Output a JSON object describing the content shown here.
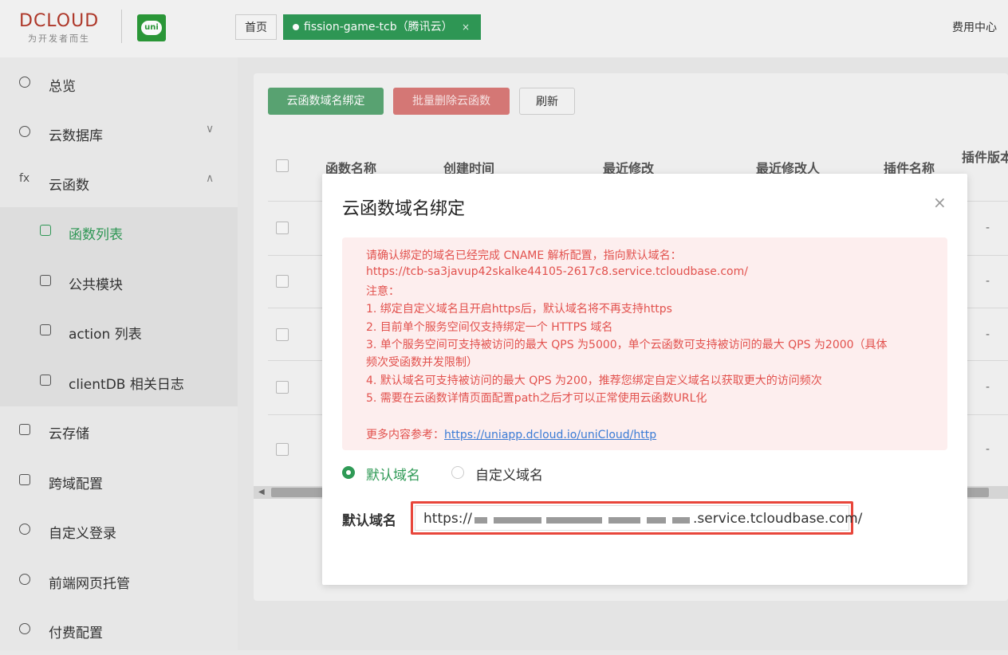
{
  "header": {
    "logo_text": "DCLOUD",
    "logo_subtitle": "为开发者而生",
    "uni_badge": "uni",
    "tabs": [
      {
        "label": "首页"
      },
      {
        "label": "fission-game-tcb（腾讯云）",
        "close": "×"
      }
    ],
    "fee_center": "费用中心"
  },
  "sidebar": {
    "items": [
      {
        "label": "总览",
        "icon": "overview-icon"
      },
      {
        "label": "云数据库",
        "icon": "database-icon",
        "arrow": "∨"
      },
      {
        "label": "云函数",
        "icon": "fx-icon",
        "icon_text": "fx",
        "arrow": "∧"
      },
      {
        "label": "函数列表",
        "icon": "list-icon"
      },
      {
        "label": "公共模块",
        "icon": "cube-icon"
      },
      {
        "label": "action 列表",
        "icon": "doc-icon"
      },
      {
        "label": "clientDB 相关日志",
        "icon": "log-icon"
      },
      {
        "label": "云存储",
        "icon": "storage-icon"
      },
      {
        "label": "跨域配置",
        "icon": "cors-icon"
      },
      {
        "label": "自定义登录",
        "icon": "shield-icon"
      },
      {
        "label": "前端网页托管",
        "icon": "hosting-icon"
      },
      {
        "label": "付费配置",
        "icon": "payment-icon"
      }
    ]
  },
  "main": {
    "buttons": {
      "bind_domain": "云函数域名绑定",
      "batch_delete": "批量删除云函数",
      "refresh": "刷新"
    },
    "columns": [
      "函数名称",
      "创建时间",
      "最近修改",
      "最近修改人",
      "插件名称",
      "插件版本号"
    ],
    "row_dash": "-"
  },
  "dialog": {
    "title": "云函数域名绑定",
    "close": "×",
    "alert_lines": [
      "请确认绑定的域名已经完成 CNAME 解析配置，指向默认域名：",
      "https://tcb-sa3javup42skalke44105-2617c8.service.tcloudbase.com/",
      "注意：",
      "1. 绑定自定义域名且开启https后，默认域名将不再支持https",
      "2. 目前单个服务空间仅支持绑定一个 HTTPS 域名",
      "3. 单个服务空间可支持被访问的最大 QPS 为5000，单个云函数可支持被访问的最大 QPS 为2000（具体",
      "频次受函数并发限制）",
      "4. 默认域名可支持被访问的最大 QPS 为200，推荐您绑定自定义域名以获取更大的访问频次",
      "5. 需要在云函数详情页面配置path之后才可以正常使用云函数URL化"
    ],
    "more_ref_label": "更多内容参考：",
    "more_ref_link": "https://uniapp.dcloud.io/uniCloud/http",
    "radio_default": "默认域名",
    "radio_custom": "自定义域名",
    "field_label": "默认域名",
    "field_prefix": "https://",
    "field_suffix": ".service.tcloudbase.com/"
  },
  "colors": {
    "accent_green": "#2f9a56",
    "alert_red": "#e2514d",
    "highlight_box": "#e8463b"
  }
}
